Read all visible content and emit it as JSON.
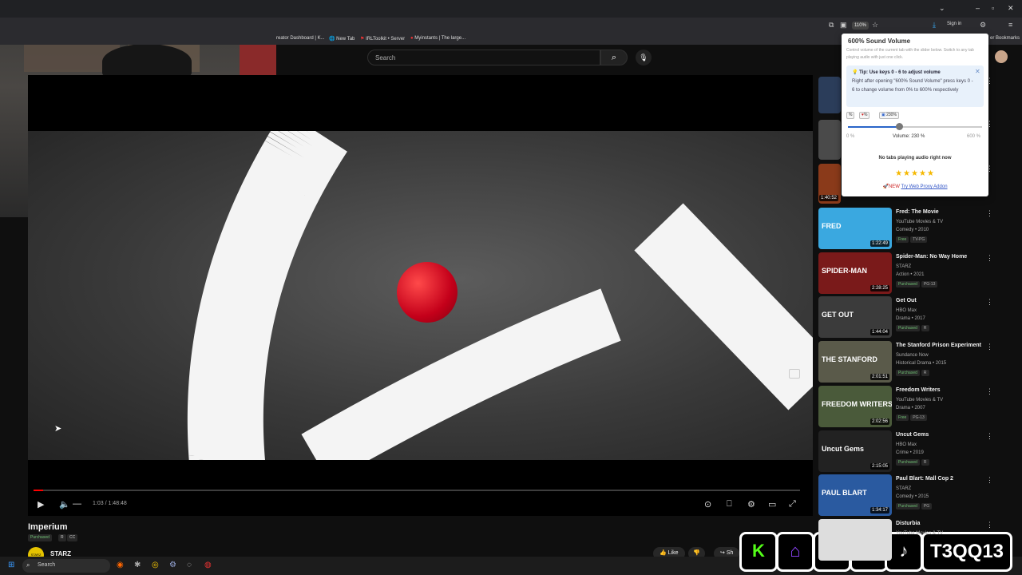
{
  "browser": {
    "zoom": "110%",
    "signin": "Sign in",
    "bookmarks": [
      "reator Dashboard | K...",
      "New Tab",
      "IRLToolkit • Server",
      "Myinstants | The large...",
      "er Bookmarks"
    ]
  },
  "youtube": {
    "search_placeholder": "Search",
    "player": {
      "time": "1:03 / 1:48:48",
      "progress_fraction": 0.0097
    },
    "video": {
      "title": "Imperium",
      "badges": [
        "Purchased",
        "R",
        "CC"
      ],
      "channel": "STARZ",
      "channel_avatar": "STARZ",
      "like": "Like",
      "share": "Sh"
    },
    "sidebar": [
      {
        "title": "Fred: The Movie",
        "channel": "YouTube Movies & TV",
        "meta": "Comedy • 2010",
        "badges": [
          "Free",
          "TV-PG"
        ],
        "duration": "1:22:49",
        "thumb_text": "FRED",
        "thumb_color": "#3aa8e0"
      },
      {
        "title": "Spider-Man: No Way Home",
        "channel": "STARZ",
        "meta": "Action • 2021",
        "badges": [
          "Purchased",
          "PG-13"
        ],
        "duration": "2:28:25",
        "thumb_text": "SPIDER-MAN",
        "thumb_color": "#7a1a1a"
      },
      {
        "title": "Get Out",
        "channel": "HBO Max",
        "meta": "Drama • 2017",
        "badges": [
          "Purchased",
          "R"
        ],
        "duration": "1:44:04",
        "thumb_text": "GET OUT",
        "thumb_color": "#3b3b3b"
      },
      {
        "title": "The Stanford Prison Experiment",
        "channel": "Sundance Now",
        "meta": "Historical Drama • 2015",
        "badges": [
          "Purchased",
          "R"
        ],
        "duration": "2:01:51",
        "thumb_text": "THE STANFORD",
        "thumb_color": "#5a5a4a"
      },
      {
        "title": "Freedom Writers",
        "channel": "YouTube Movies & TV",
        "meta": "Drama • 2007",
        "badges": [
          "Free",
          "PG-13"
        ],
        "duration": "2:02:56",
        "thumb_text": "FREEDOM WRITERS",
        "thumb_color": "#4a5a3a"
      },
      {
        "title": "Uncut Gems",
        "channel": "HBO Max",
        "meta": "Crime • 2019",
        "badges": [
          "Purchased",
          "R"
        ],
        "duration": "2:15:05",
        "thumb_text": "Uncut Gems",
        "thumb_color": "#222"
      },
      {
        "title": "Paul Blart: Mall Cop 2",
        "channel": "STARZ",
        "meta": "Comedy • 2015",
        "badges": [
          "Purchased",
          "PG"
        ],
        "duration": "1:34:17",
        "thumb_text": "PAUL BLART",
        "thumb_color": "#2a5aa0"
      },
      {
        "title": "Disturbia",
        "channel": "YouTube Movies & TV",
        "meta": "",
        "badges": [],
        "duration": "",
        "thumb_text": "",
        "thumb_color": "#ddd"
      }
    ],
    "partial_durations": [
      "1:40:52"
    ]
  },
  "extension": {
    "title": "600% Sound Volume",
    "subtitle": "Control volume of the current tab with the slider below. Switch to any tab playing audio with just one click.",
    "tip_title": "Tip: Use keys 0 - 6 to adjust volume",
    "tip_text": "Right after opening \"600% Sound Volume\" press keys 0 - 6 to change volume from 0% to 600% respectively",
    "buttons": [
      "%",
      "%",
      "230%"
    ],
    "volume_fraction": 0.3833,
    "vol_min": "0 %",
    "vol_label": "Volume: 230 %",
    "vol_max": "600 %",
    "no_tabs": "No tabs playing audio right now",
    "stars": "★★★★★",
    "new_prefix": "NEW",
    "new_link": "Try Web Proxy Addon"
  },
  "taskbar": {
    "search": "Search"
  },
  "overlay": {
    "handle": "T3QQ13",
    "socials": [
      "kick",
      "twitch",
      "youtube",
      "x",
      "tiktok"
    ]
  }
}
